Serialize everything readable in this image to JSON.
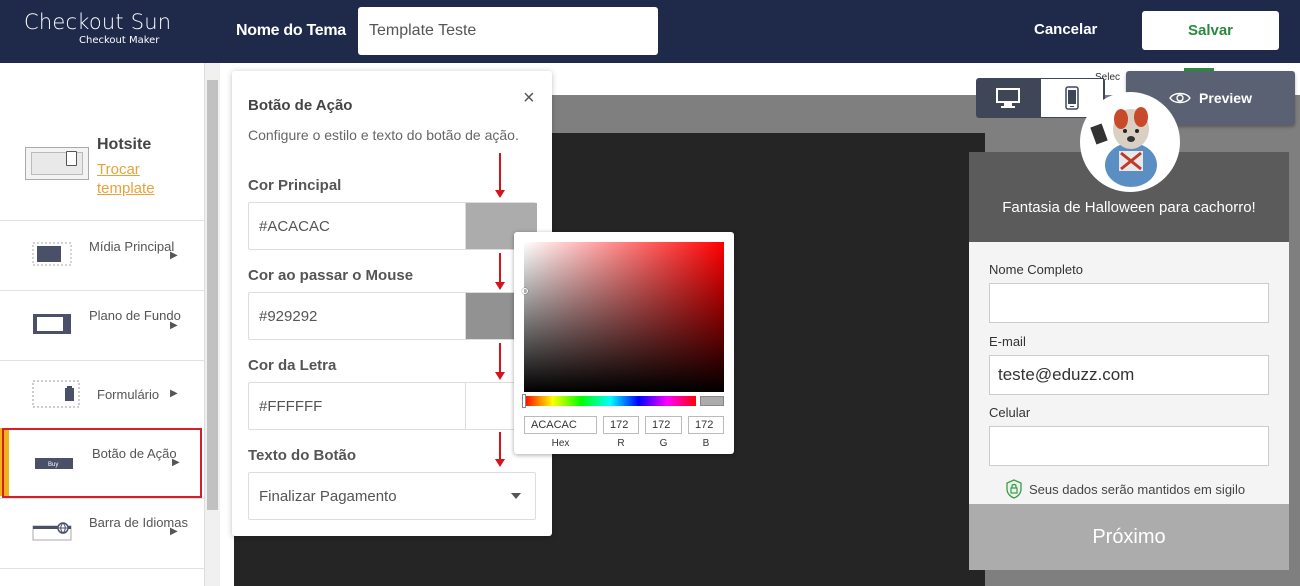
{
  "app": {
    "logo_title": "Checkout Sun",
    "logo_subtitle": "Checkout Maker"
  },
  "header": {
    "theme_label": "Nome do Tema",
    "theme_value": "Template Teste",
    "cancel_label": "Cancelar",
    "save_label": "Salvar"
  },
  "sidebar": {
    "hotsite_title": "Hotsite",
    "hotsite_link": "Trocar template",
    "items": [
      {
        "label": "Mídia Principal"
      },
      {
        "label": "Plano de Fundo"
      },
      {
        "label": "Formulário"
      },
      {
        "label": "Botão de Ação",
        "active": true
      },
      {
        "label": "Barra de Idiomas"
      }
    ]
  },
  "panel": {
    "title": "Botão de Ação",
    "close_glyph": "×",
    "description": "Configure o estilo e texto do botão de ação.",
    "fields": [
      {
        "label": "Cor Principal",
        "value": "#ACACAC",
        "swatch": "#acacac"
      },
      {
        "label": "Cor ao passar o Mouse",
        "value": "#929292",
        "swatch": "#929292"
      },
      {
        "label": "Cor da Letra",
        "value": "#FFFFFF",
        "swatch": "#ffffff"
      }
    ],
    "button_text_label": "Texto do Botão",
    "button_text_value": "Finalizar Pagamento"
  },
  "color_picker": {
    "hex": "ACACAC",
    "r": "172",
    "g": "172",
    "b": "172",
    "captions": {
      "hex": "Hex",
      "r": "R",
      "g": "G",
      "b": "B"
    }
  },
  "toolbar": {
    "preview_label": "Preview",
    "select_hint": "Selec"
  },
  "checkout": {
    "product_title": "Fantasia de Halloween para cachorro!",
    "name_label": "Nome Completo",
    "name_value": "",
    "email_label": "E-mail",
    "email_value": "teste@eduzz.com",
    "phone_label": "Celular",
    "phone_value": "",
    "secure_text": "Seus dados serão mantidos em sigilo",
    "next_label": "Próximo"
  },
  "colors": {
    "topbar": "#1f2a4b",
    "accent_active": "#f3b21a",
    "highlight_border": "#d51d2b",
    "save_text": "#2a8a3e",
    "button_main": "#acacac"
  },
  "icons": [
    "close-icon",
    "desktop-icon",
    "mobile-icon",
    "eye-icon",
    "shield-icon",
    "chevron-right-icon",
    "chevron-down-icon"
  ]
}
